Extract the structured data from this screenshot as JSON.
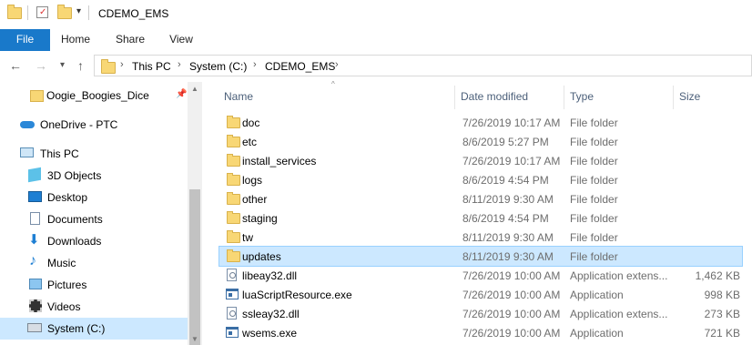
{
  "window": {
    "title": "CDEMO_EMS"
  },
  "ribbon": {
    "tabs": [
      "File",
      "Home",
      "Share",
      "View"
    ]
  },
  "address": {
    "crumbs": [
      "This PC",
      "System (C:)",
      "CDEMO_EMS"
    ]
  },
  "nav": {
    "items": [
      {
        "label": "Oogie_Boogies_Dice",
        "icon": "folder-icon"
      },
      {
        "label": "OneDrive - PTC",
        "icon": "cloud-icon"
      },
      {
        "label": "This PC",
        "icon": "computer-icon"
      },
      {
        "label": "3D Objects",
        "icon": "cube-icon"
      },
      {
        "label": "Desktop",
        "icon": "desktop-icon"
      },
      {
        "label": "Documents",
        "icon": "documents-icon"
      },
      {
        "label": "Downloads",
        "icon": "downloads-icon"
      },
      {
        "label": "Music",
        "icon": "music-icon"
      },
      {
        "label": "Pictures",
        "icon": "pictures-icon"
      },
      {
        "label": "Videos",
        "icon": "videos-icon"
      },
      {
        "label": "System (C:)",
        "icon": "drive-icon"
      }
    ]
  },
  "columns": {
    "name": "Name",
    "date": "Date modified",
    "type": "Type",
    "size": "Size"
  },
  "files": [
    {
      "name": "doc",
      "date": "7/26/2019 10:17 AM",
      "type": "File folder",
      "size": ""
    },
    {
      "name": "etc",
      "date": "8/6/2019 5:27 PM",
      "type": "File folder",
      "size": ""
    },
    {
      "name": "install_services",
      "date": "7/26/2019 10:17 AM",
      "type": "File folder",
      "size": ""
    },
    {
      "name": "logs",
      "date": "8/6/2019 4:54 PM",
      "type": "File folder",
      "size": ""
    },
    {
      "name": "other",
      "date": "8/11/2019 9:30 AM",
      "type": "File folder",
      "size": ""
    },
    {
      "name": "staging",
      "date": "8/6/2019 4:54 PM",
      "type": "File folder",
      "size": ""
    },
    {
      "name": "tw",
      "date": "8/11/2019 9:30 AM",
      "type": "File folder",
      "size": ""
    },
    {
      "name": "updates",
      "date": "8/11/2019 9:30 AM",
      "type": "File folder",
      "size": ""
    },
    {
      "name": "libeay32.dll",
      "date": "7/26/2019 10:00 AM",
      "type": "Application extens...",
      "size": "1,462 KB"
    },
    {
      "name": "luaScriptResource.exe",
      "date": "7/26/2019 10:00 AM",
      "type": "Application",
      "size": "998 KB"
    },
    {
      "name": "ssleay32.dll",
      "date": "7/26/2019 10:00 AM",
      "type": "Application extens...",
      "size": "273 KB"
    },
    {
      "name": "wsems.exe",
      "date": "7/26/2019 10:00 AM",
      "type": "Application",
      "size": "721 KB"
    }
  ],
  "colors": {
    "accent": "#1979ca",
    "selection": "#cce8ff",
    "folder": "#f8d775"
  }
}
